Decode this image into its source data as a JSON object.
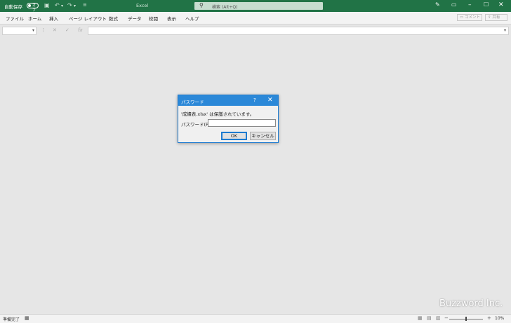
{
  "titlebar": {
    "autosave_label": "自動保存",
    "autosave_toggle": "オフ",
    "app_title": "Excel",
    "search_placeholder": "検索 (Alt+Q)",
    "colors": {
      "bar": "#217346"
    }
  },
  "ribbon": {
    "tabs": [
      "ファイル",
      "ホーム",
      "挿入",
      "ページ レイアウト",
      "数式",
      "データ",
      "校閲",
      "表示",
      "ヘルプ"
    ],
    "comment_label": "コメント",
    "share_label": "共有"
  },
  "formula_bar": {
    "name_box": "",
    "formula": "",
    "fx_label": "fx",
    "cancel_glyph": "✕",
    "enter_glyph": "✓"
  },
  "dialog": {
    "title": "パスワード",
    "help_glyph": "?",
    "close_glyph": "✕",
    "message": "'成績表.xlsx' は保護されています。",
    "password_label": "パスワード(P):",
    "password_value": "",
    "ok_label": "OK",
    "cancel_label": "キャンセル",
    "colors": {
      "title_bg": "#2b88d8"
    }
  },
  "statusbar": {
    "status": "準備完了",
    "zoom": "10%",
    "zoom_level_fraction": 0.5
  },
  "watermark": "Buzzword Inc."
}
